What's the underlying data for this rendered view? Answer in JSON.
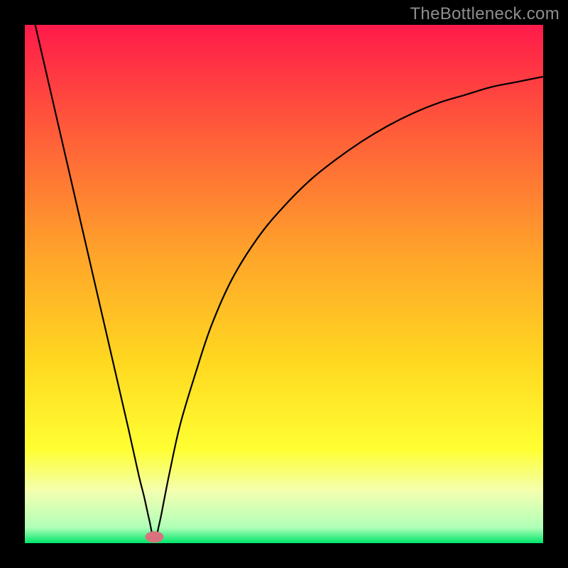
{
  "credit": "TheBottleneck.com",
  "colors": {
    "border": "#000000",
    "curve": "#000000",
    "marker": "#d9727d",
    "gradient_stops": [
      {
        "offset": "0%",
        "color": "#ff1a4a"
      },
      {
        "offset": "20%",
        "color": "#ff5a3a"
      },
      {
        "offset": "45%",
        "color": "#ffa62a"
      },
      {
        "offset": "65%",
        "color": "#ffd820"
      },
      {
        "offset": "82%",
        "color": "#ffff33"
      },
      {
        "offset": "90%",
        "color": "#f3ffb0"
      },
      {
        "offset": "97%",
        "color": "#b0ffb8"
      },
      {
        "offset": "100%",
        "color": "#00e66a"
      }
    ]
  },
  "chart_data": {
    "type": "line",
    "title": "",
    "xlabel": "",
    "ylabel": "",
    "xlim": [
      0,
      100
    ],
    "ylim": [
      0,
      100
    ],
    "grid": false,
    "legend": false,
    "optimal_x": 25,
    "marker": {
      "x": 25,
      "y": 1.2
    },
    "x": [
      2,
      5,
      8,
      11,
      14,
      17,
      20,
      22,
      23,
      24,
      25,
      26,
      27,
      28,
      30,
      33,
      36,
      40,
      45,
      50,
      55,
      60,
      65,
      70,
      75,
      80,
      85,
      90,
      95,
      100
    ],
    "values": [
      100,
      87,
      74,
      61,
      48,
      35,
      22,
      13,
      9,
      4.5,
      0.6,
      4,
      9,
      14,
      23,
      33,
      42,
      51,
      59,
      65,
      70,
      74,
      77.5,
      80.5,
      83,
      85,
      86.5,
      88,
      89,
      90
    ]
  }
}
